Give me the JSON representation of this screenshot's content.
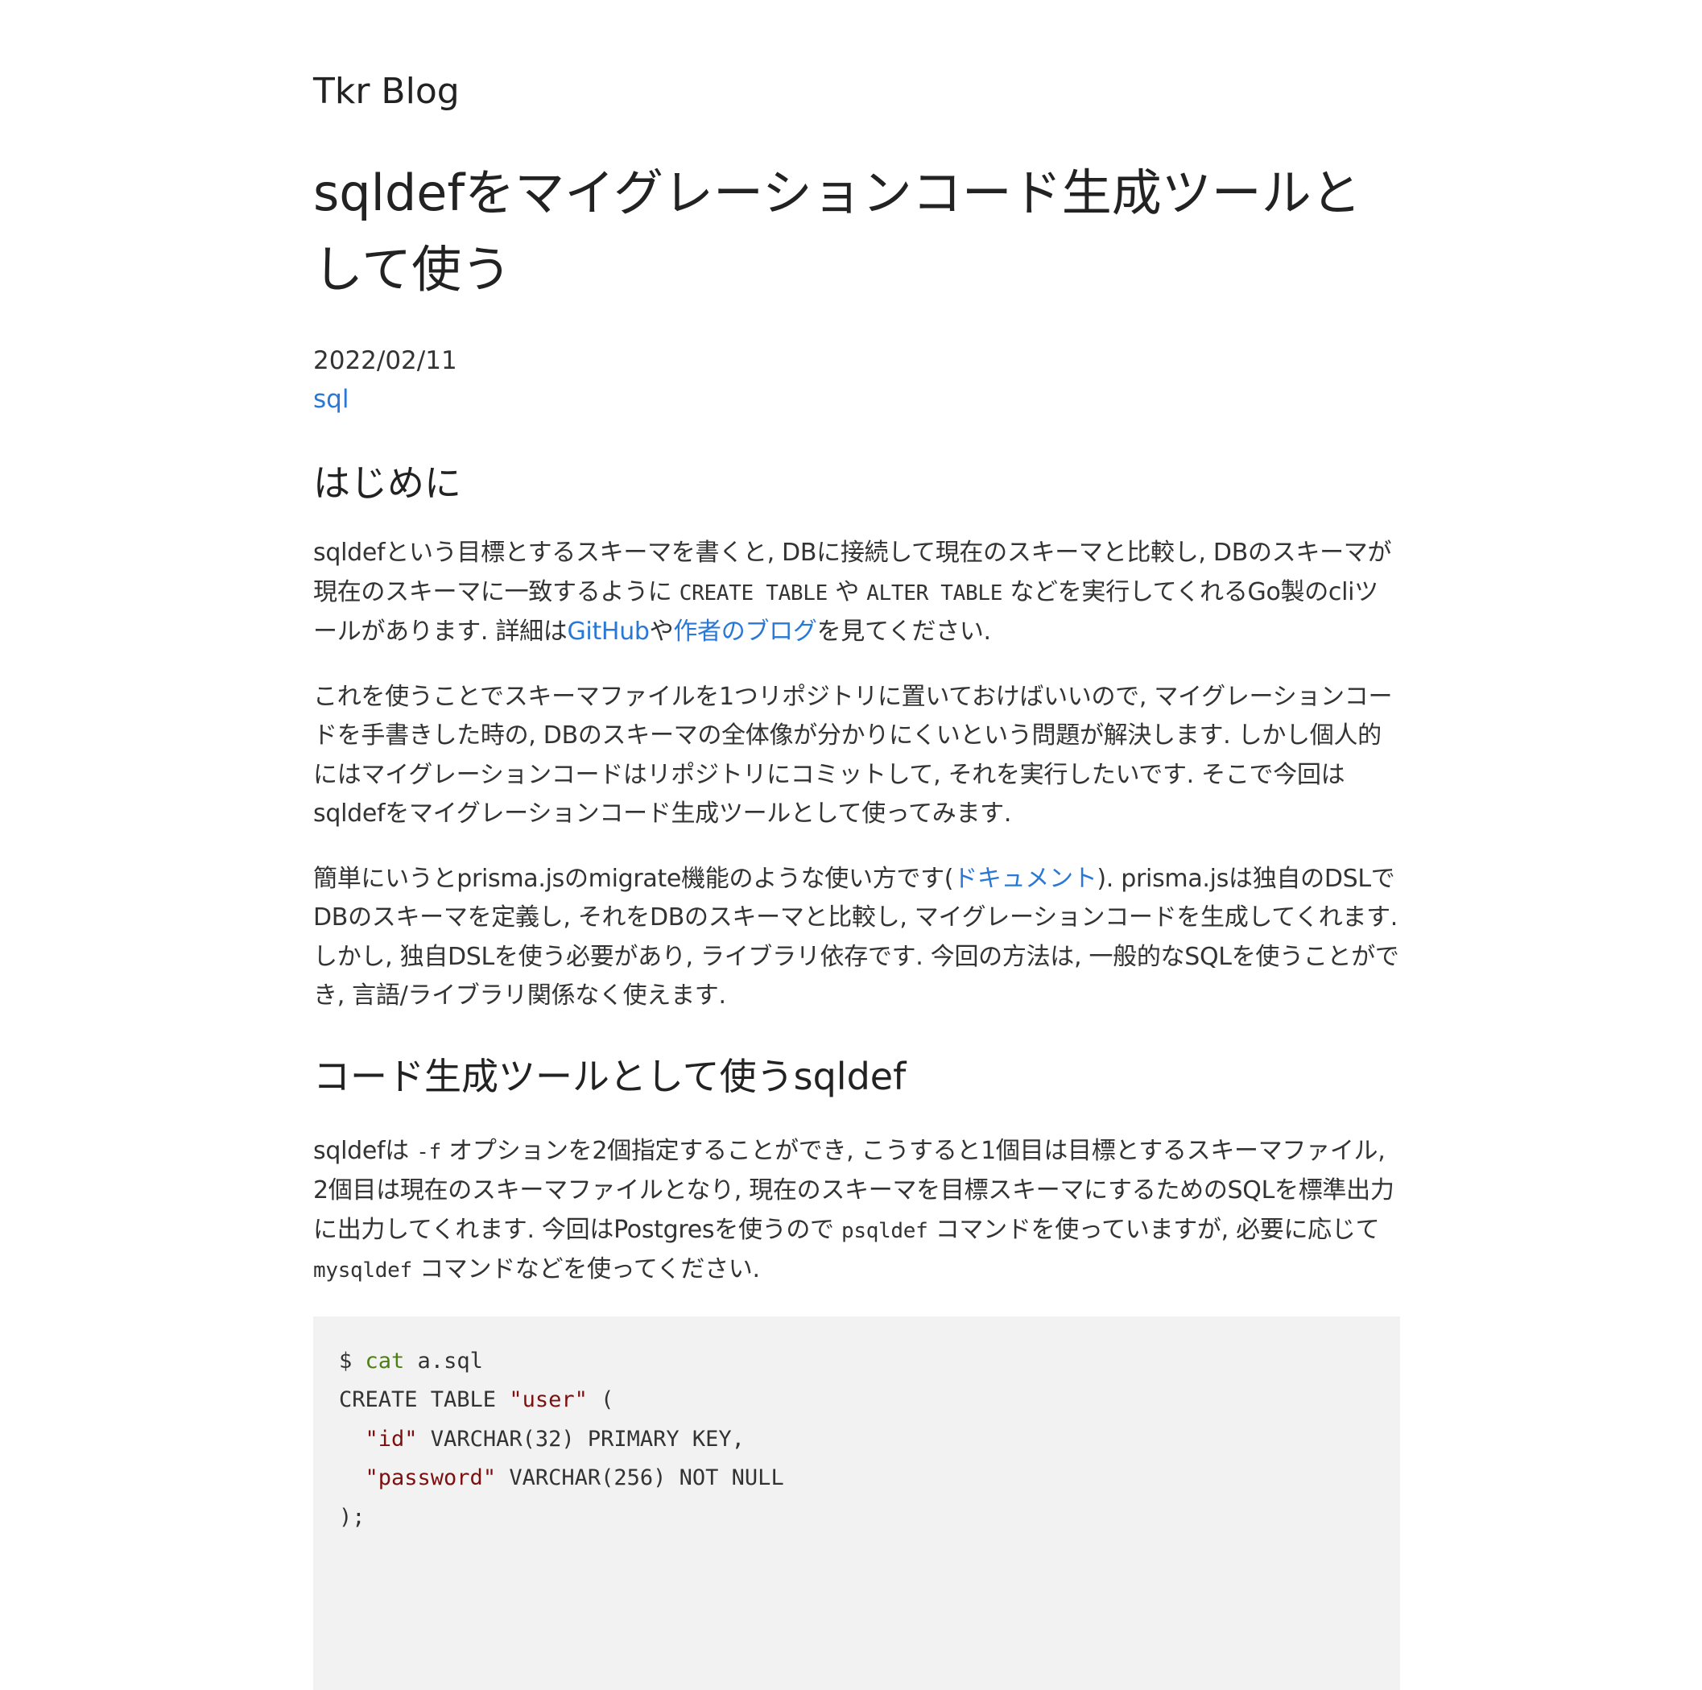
{
  "blog_title": "Tkr Blog",
  "post": {
    "title": "sqldefをマイグレーションコード生成ツールとして使う",
    "date": "2022/02/11",
    "tag": "sql"
  },
  "sections": {
    "intro_heading": "はじめに",
    "p1": {
      "a": "sqldefという目標とするスキーマを書くと, DBに接続して現在のスキーマと比較し, DBのスキーマが現在のスキーマに一致するように ",
      "code1": "CREATE TABLE",
      "b": " や ",
      "code2": "ALTER TABLE",
      "c": " などを実行してくれるGo製のcliツールがあります. 詳細は",
      "link1": "GitHub",
      "d": "や",
      "link2": "作者のブログ",
      "e": "を見てください."
    },
    "p2": "これを使うことでスキーマファイルを1つリポジトリに置いておけばいいので, マイグレーションコードを手書きした時の, DBのスキーマの全体像が分かりにくいという問題が解決します. しかし個人的にはマイグレーションコードはリポジトリにコミットして, それを実行したいです. そこで今回はsqldefをマイグレーションコード生成ツールとして使ってみます.",
    "p3": {
      "a": "簡単にいうとprisma.jsのmigrate機能のような使い方です(",
      "link": "ドキュメント",
      "b": "). prisma.jsは独自のDSLでDBのスキーマを定義し, それをDBのスキーマと比較し, マイグレーションコードを生成してくれます. しかし, 独自DSLを使う必要があり, ライブラリ依存です. 今回の方法は, 一般的なSQLを使うことができ, 言語/ライブラリ関係なく使えます."
    },
    "codegen_heading": "コード生成ツールとして使うsqldef",
    "p4": {
      "a": "sqldefは ",
      "code1": "-f",
      "b": " オプションを2個指定することができ, こうすると1個目は目標とするスキーマファイル, 2個目は現在のスキーマファイルとなり, 現在のスキーマを目標スキーマにするためのSQLを標準出力に出力してくれます. 今回はPostgresを使うので ",
      "code2": "psqldef",
      "c": " コマンドを使っていますが, 必要に応じて ",
      "code3": "mysqldef",
      "d": " コマンドなどを使ってください."
    }
  },
  "code_block": {
    "prompt": "$ ",
    "command": "cat",
    "arg": " a.sql",
    "line2a": "CREATE TABLE ",
    "line2str": "\"user\"",
    "line2b": " (",
    "line3str": "\"id\"",
    "line3b": " VARCHAR(32) PRIMARY KEY,",
    "line4str": "\"password\"",
    "line4b": " VARCHAR(256) NOT NULL",
    "line5": ");"
  }
}
